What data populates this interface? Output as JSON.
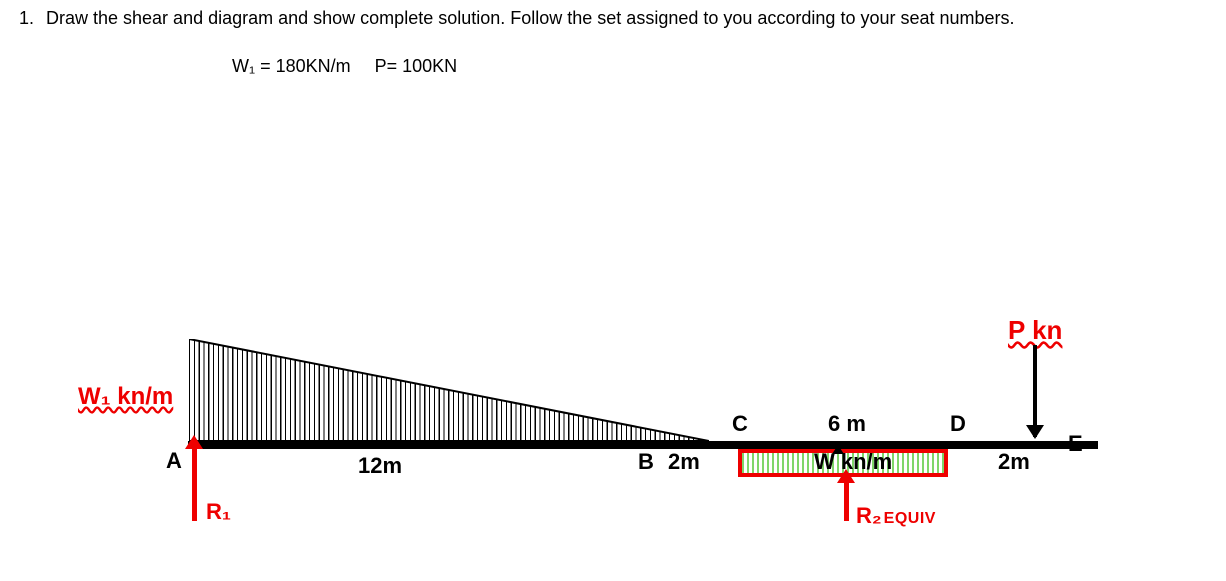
{
  "question": {
    "number": "1.",
    "text": "Draw the shear and diagram and show complete solution.  Follow the set assigned to you according to your seat numbers."
  },
  "params": {
    "w1": "W₁ = 180KN/m",
    "p": "P= 100KN"
  },
  "labels": {
    "w1": "W₁ kn/m",
    "A": "A",
    "B": "B",
    "C": "C",
    "D": "D",
    "E": "E",
    "P": "P kn",
    "W": "W  kn/m",
    "R1": "R₁",
    "R2": "R₂",
    "R2_suffix": "EQUIV"
  },
  "dims": {
    "AB": "12m",
    "BC": "2m",
    "CD": "6 m",
    "DE": "2m"
  },
  "chart_data": {
    "type": "beam-diagram",
    "points": [
      "A",
      "B",
      "C",
      "D",
      "E"
    ],
    "spans_m": {
      "AB": 12,
      "BC": 2,
      "CD": 6,
      "DE": 2
    },
    "supports": [
      {
        "at": "A",
        "name": "R1",
        "type": "reaction-up"
      },
      {
        "at_midspan_of": "CD",
        "name": "R2_equiv",
        "type": "reaction-up"
      }
    ],
    "loads": [
      {
        "type": "triangular",
        "from": "A",
        "to": "B",
        "w_at_A_kN_per_m": 180,
        "w_at_B_kN_per_m": 0,
        "name": "W1"
      },
      {
        "type": "uniform",
        "from": "C",
        "to": "D",
        "w_kN_per_m": "W",
        "direction": "up",
        "name": "W"
      },
      {
        "type": "point",
        "at": "E",
        "P_kN": 100,
        "direction": "down",
        "name": "P"
      }
    ],
    "given": {
      "W1_kN_per_m": 180,
      "P_kN": 100
    }
  }
}
